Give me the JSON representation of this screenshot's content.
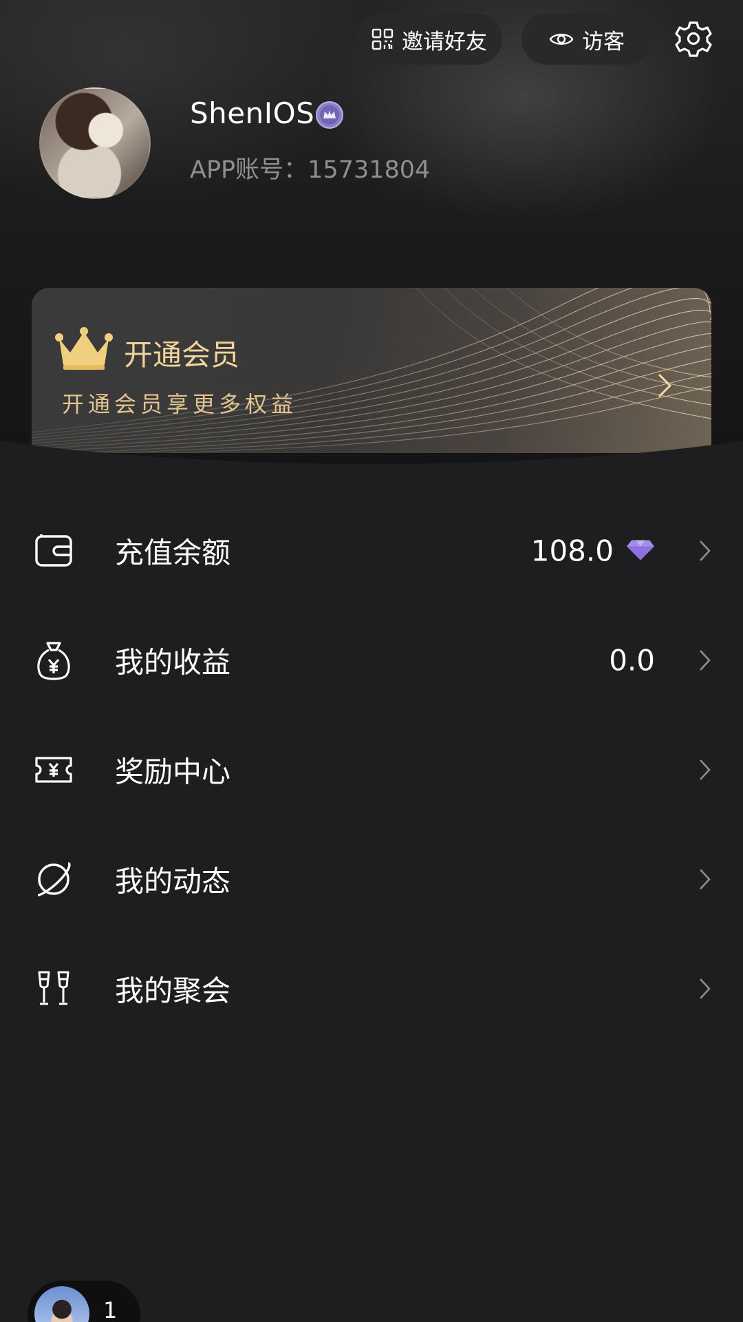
{
  "header": {
    "invite_label": "邀请好友",
    "visitor_label": "访客",
    "username": "ShenIOS",
    "account_text": "APP账号：15731804"
  },
  "vip": {
    "title": "开通会员",
    "subtitle": "开通会员享更多权益"
  },
  "menu": {
    "items": [
      {
        "label": "充值余额",
        "value": "108.0",
        "icon": "wallet-icon"
      },
      {
        "label": "我的收益",
        "value": "0.0",
        "icon": "money-bag-icon"
      },
      {
        "label": "奖励中心",
        "value": "",
        "icon": "ticket-icon"
      },
      {
        "label": "我的动态",
        "value": "",
        "icon": "planet-icon"
      },
      {
        "label": "我的聚会",
        "value": "",
        "icon": "cheers-icon"
      }
    ]
  },
  "mini_player": {
    "count": "1"
  },
  "colors": {
    "background": "#1e1e20",
    "vip_gold": "#f1d49a",
    "gem_purple": "#a58ee8"
  }
}
